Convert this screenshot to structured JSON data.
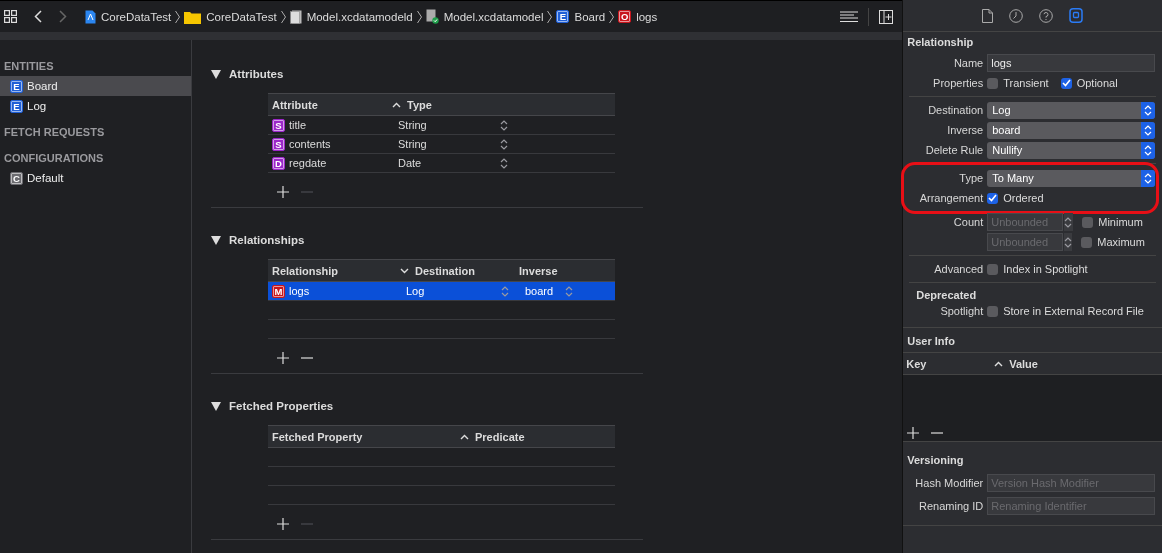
{
  "toolbar": {
    "breadcrumbs": [
      {
        "kind": "project",
        "label": "CoreDataTest"
      },
      {
        "kind": "folder",
        "label": "CoreDataTest"
      },
      {
        "kind": "model-bundle",
        "label": "Model.xcdatamodeld"
      },
      {
        "kind": "model",
        "label": "Model.xcdatamodel"
      },
      {
        "kind": "badge",
        "badge": "E",
        "color": "#1f5fd6",
        "label": "Board"
      },
      {
        "kind": "badge",
        "badge": "O",
        "color": "#c8161d",
        "label": "logs"
      }
    ]
  },
  "sidebar": {
    "sections": [
      {
        "title": "ENTITIES",
        "items": [
          {
            "badge": "E",
            "color": "#1f5fd6",
            "label": "Board",
            "selected": true
          },
          {
            "badge": "E",
            "color": "#1f5fd6",
            "label": "Log",
            "selected": false
          }
        ]
      },
      {
        "title": "FETCH REQUESTS"
      },
      {
        "title": "CONFIGURATIONS",
        "items": [
          {
            "badge": "C",
            "color": "#6b6b70",
            "label": "Default",
            "selected": false
          }
        ]
      }
    ]
  },
  "editor": {
    "sections": [
      {
        "kind": "attributes",
        "title": "Attributes",
        "expanded": true,
        "columns": [
          {
            "label": "Attribute"
          },
          {
            "label": "Type",
            "sorted": true,
            "descending": false
          }
        ],
        "rows": [
          {
            "badge": "S",
            "color": "#9b27c9",
            "cells": [
              "title",
              "String"
            ],
            "selected": false
          },
          {
            "badge": "S",
            "color": "#9b27c9",
            "cells": [
              "contents",
              "String"
            ],
            "selected": false
          },
          {
            "badge": "D",
            "color": "#9b27c9",
            "cells": [
              "regdate",
              "Date"
            ],
            "selected": false
          }
        ],
        "remove_disabled": true
      },
      {
        "kind": "relationships",
        "title": "Relationships",
        "expanded": true,
        "columns": [
          {
            "label": "Relationship"
          },
          {
            "label": "Destination",
            "sorted": true,
            "descending": true
          },
          {
            "label": "Inverse"
          }
        ],
        "rows": [
          {
            "badge": "M",
            "color": "#c8161d",
            "cells": [
              "logs",
              "Log",
              "board"
            ],
            "selected": true
          }
        ],
        "remove_disabled": false
      },
      {
        "kind": "fetched",
        "title": "Fetched Properties",
        "expanded": true,
        "columns": [
          {
            "label": "Fetched Property"
          },
          {
            "label": "Predicate",
            "sorted": true,
            "descending": false
          }
        ],
        "remove_disabled": true
      }
    ]
  },
  "inspector": {
    "tabs": [
      {
        "kind": "file",
        "selected": false
      },
      {
        "kind": "history",
        "selected": false
      },
      {
        "kind": "help",
        "selected": false
      },
      {
        "kind": "data-model",
        "selected": true
      }
    ],
    "relationship": {
      "title": "Relationship",
      "rows": [
        {
          "kind": "text-field",
          "label": "Name",
          "value": "logs"
        },
        {
          "kind": "checkboxes",
          "label": "Properties",
          "options": [
            {
              "label": "Transient",
              "checked": false
            },
            {
              "label": "Optional",
              "checked": true
            }
          ]
        },
        {
          "kind": "divider"
        },
        {
          "kind": "popup",
          "label": "Destination",
          "value": "Log"
        },
        {
          "kind": "popup",
          "label": "Inverse",
          "value": "board"
        },
        {
          "kind": "popup",
          "label": "Delete Rule",
          "value": "Nullify"
        },
        {
          "kind": "divider"
        },
        {
          "kind": "popup",
          "label": "Type",
          "value": "To Many",
          "circled": true
        },
        {
          "kind": "checkboxes",
          "label": "Arrangement",
          "options": [
            {
              "label": "Ordered",
              "checked": true
            }
          ],
          "circled": true
        },
        {
          "kind": "count",
          "label": "Count",
          "placeholder": "Unbounded",
          "option": {
            "label": "Minimum",
            "checked": false
          }
        },
        {
          "kind": "count",
          "placeholder": "Unbounded",
          "option": {
            "label": "Maximum",
            "checked": false
          }
        },
        {
          "kind": "divider"
        },
        {
          "kind": "checkboxes",
          "label": "Advanced",
          "options": [
            {
              "label": "Index in Spotlight",
              "checked": false
            }
          ]
        },
        {
          "kind": "divider"
        },
        {
          "kind": "heading",
          "label": "Deprecated"
        },
        {
          "kind": "checkboxes",
          "label": "Spotlight",
          "options": [
            {
              "label": "Store in External Record File",
              "checked": false
            }
          ]
        }
      ]
    },
    "user_info": {
      "title": "User Info",
      "columns": [
        {
          "label": "Key"
        },
        {
          "label": "Value",
          "sorted": true,
          "descending": false
        }
      ],
      "remove_disabled": false
    },
    "versioning": {
      "title": "Versioning",
      "fields": [
        {
          "label": "Hash Modifier",
          "placeholder": "Version Hash Modifier"
        },
        {
          "label": "Renaming ID",
          "placeholder": "Renaming Identifier"
        }
      ]
    }
  }
}
